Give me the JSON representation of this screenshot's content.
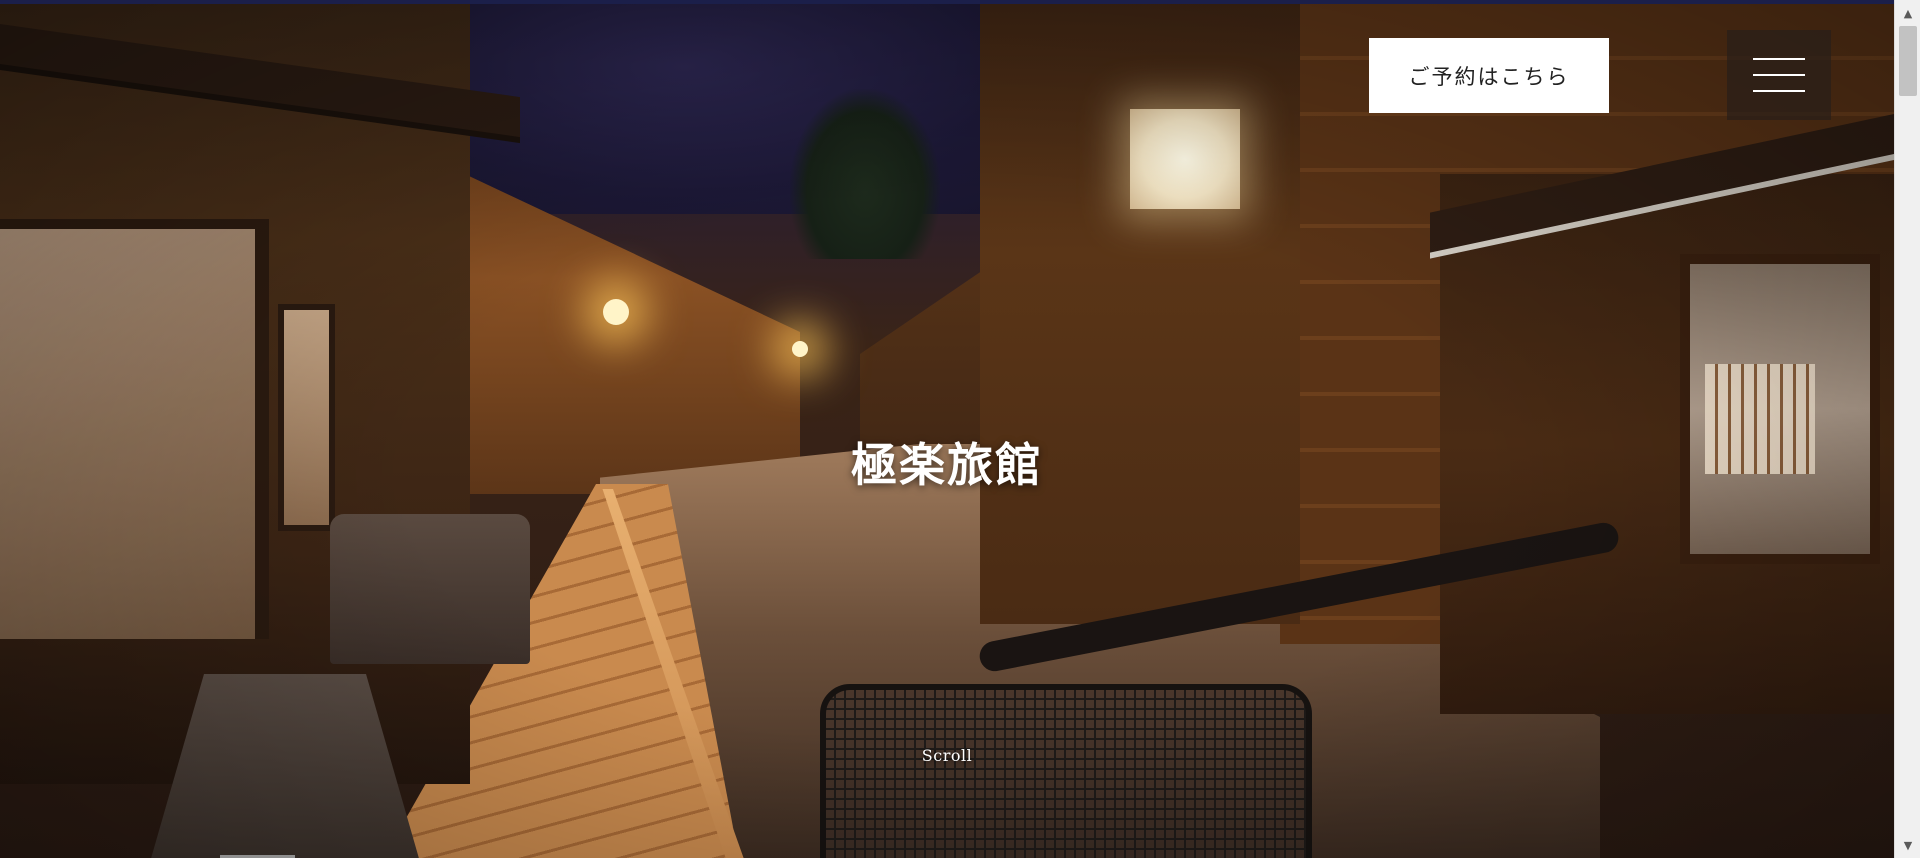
{
  "hero": {
    "title": "極楽旅館",
    "scroll_label": "Scroll",
    "image_description_icon": "night-street-photo"
  },
  "header": {
    "reserve_label": "ご予約はこちら",
    "menu_icon": "hamburger-menu-icon"
  },
  "scrollbar": {
    "up_arrow": "▲",
    "down_arrow": "▼"
  },
  "colors": {
    "top_strip": "#1b1f4a",
    "button_bg": "#ffffff",
    "button_text": "#222222",
    "menu_bg": "#2a1e19",
    "title_text": "#ffffff"
  }
}
